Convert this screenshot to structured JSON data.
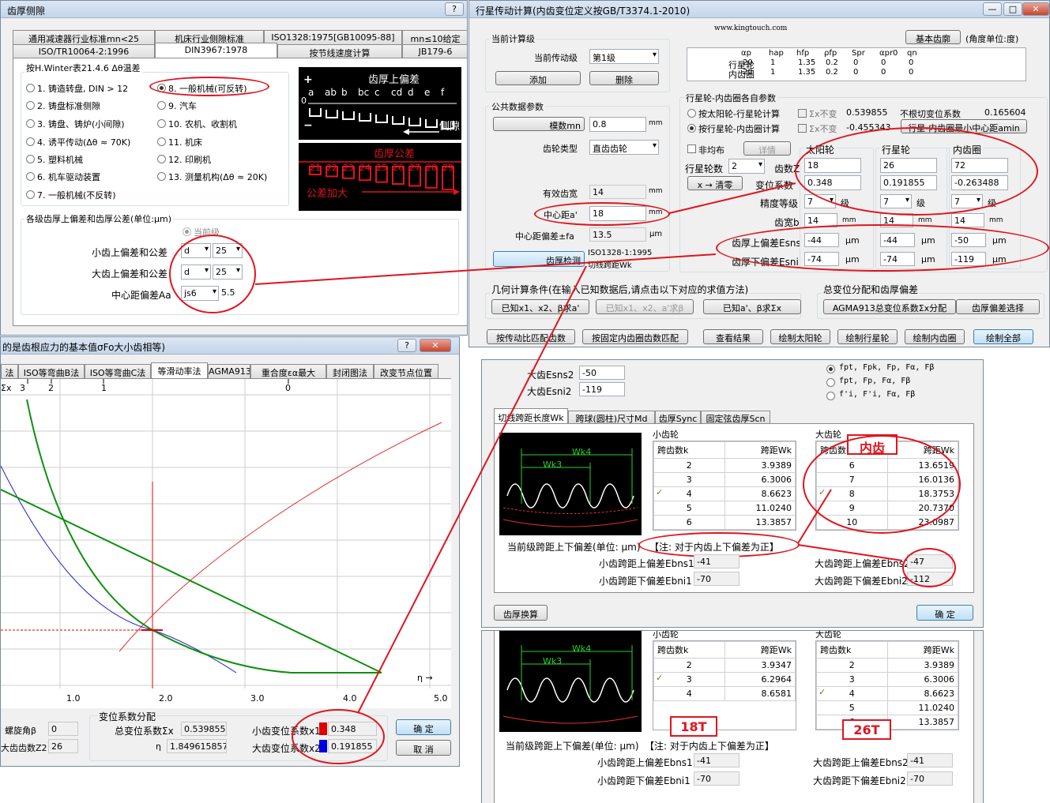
{
  "w1": {
    "title": "齿厚侧隙",
    "tabs_row1": [
      "通用减速器行业标准mn<25",
      "机床行业侧隙标准",
      "ISO1328:1975[GB10095-88]",
      "mn≤10给定"
    ],
    "tabs_row2": [
      "ISO/TR10064-2:1996",
      "DIN3967:1978",
      "按节线速度计算",
      "JB179-6"
    ],
    "group_title": "按H.Winter表21.4.6 Δθ温差",
    "options": [
      "1. 铸造转盘, DIN > 12",
      "2. 铸盘标准侧隙",
      "3. 铸盘、铸炉(小间隙)",
      "4. 诱平传动(Δθ ≈ 70K)",
      "5. 塑料机械",
      "6. 机车驱动装置",
      "7. 一般机械(不反转)",
      "8. 一般机械(可反转)",
      "9. 汽车",
      "10. 农机、收割机",
      "11. 机床",
      "12. 印刷机",
      "13. 测量机构(Δθ ≈ 20K)"
    ],
    "img_top_title": "齿厚上偏差",
    "img_top_letters": [
      "a",
      "ab",
      "b",
      "bc",
      "c",
      "cd",
      "d",
      "e",
      "f"
    ],
    "img_top_plus": "+",
    "img_top_zero": "0",
    "img_top_minus": "−",
    "img_top_label": "侧隙",
    "img_bot_title": "齿厚公差",
    "img_bot_nums": [
      "21",
      "22",
      "23",
      "24",
      "25",
      "26",
      "27",
      "28",
      "29"
    ],
    "img_bot_label": "公差加大",
    "sec_title": "各级齿厚上偏差和齿厚公差(单位:μm)",
    "current": "当前级",
    "small_label": "小齿上偏差和公差",
    "small_a": "d",
    "small_b": "25",
    "big_label": "大齿上偏差和公差",
    "big_a": "d",
    "big_b": "25",
    "cd_label": "中心距偏差Aa",
    "cd_sel": "js6",
    "cd_val": "5.5"
  },
  "w2": {
    "title": "的是齿根应力的基本值σFo大小齿相等)",
    "tabs": [
      "法",
      "ISO等弯曲B法",
      "ISO等弯曲C法",
      "等滑动率法",
      "AGMA913",
      "重合度εα最大",
      "封闭图法",
      "改变节点位置"
    ],
    "sx_label": "Σx",
    "top_ticks": [
      "3",
      "2",
      "1",
      "0"
    ],
    "x_ticks": [
      "1.0",
      "2.0",
      "3.0",
      "4.0",
      "5.0"
    ],
    "eta": "η →",
    "helix_label": "螺旋角β",
    "helix_val": "0",
    "z2_label": "大齿齿数Z2",
    "z2_val": "26",
    "dist_title": "变位系数分配",
    "sum_label": "总变位系数Σx",
    "sum_val": "0.539855",
    "eta_label": "η",
    "eta_val": "1.849615857",
    "x1_label": "小齿变位系数x1",
    "x1_val": "0.348",
    "x2_label": "大齿变位系数x2",
    "x2_val": "0.191855",
    "ok": "确 定",
    "cancel": "取 消"
  },
  "w3": {
    "title": "行星传动计算(内齿变位定义按GB/T3374.1-2010)",
    "website": "www.kingtouch.com",
    "basic_btn": "基本齿廓",
    "angle_unit": "(角度单位:度)",
    "stage_title": "当前计算级",
    "stage_label": "当前传动级",
    "stage_val": "第1级",
    "add": "添加",
    "del": "删除",
    "tbl_head": [
      "αp",
      "hap",
      "hfp",
      "ρfp",
      "Spr",
      "αpr0",
      "qn"
    ],
    "tbl_rows": [
      {
        "name": "行星轮",
        "v": [
          "20",
          "1",
          "1.35",
          "0.2",
          "0",
          "0",
          "0"
        ]
      },
      {
        "name": "内齿圈",
        "v": [
          "20",
          "1",
          "1.35",
          "0.2",
          "0",
          "0",
          "0"
        ]
      }
    ],
    "common_title": "公共数据参数",
    "mn_btn": "模数mn",
    "mn_val": "0.8",
    "mm": "mm",
    "type_label": "齿轮类型",
    "type_val": "直齿齿轮",
    "eff_label": "有效齿宽",
    "eff_val": "14",
    "cd_label": "中心距a'",
    "cd_val": "18",
    "cdd_label": "中心距偏差±fa",
    "cdd_val": "13.5",
    "um": "μm",
    "check_btn": "齿厚检测",
    "iso": "ISO1328-1:1995",
    "wk": "切线跨距Wk",
    "own_title": "行星轮-内齿圈各自参数",
    "r1": "按太阳轮-行星轮计算",
    "r2": "按行星轮-内齿圈计算",
    "sx1": "Σx不变",
    "sx1_val": "0.539855",
    "sx2": "Σx不变",
    "sx2_val": "-0.455343",
    "undercut": "不根切变位系数",
    "undercut_val": "0.165604",
    "amin_btn": "行星-内齿圈最小中心距amin",
    "nonuni": "非均布",
    "detail": "详情",
    "planets_label": "行星轮数",
    "planets_val": "2",
    "clear_btn": "x → 清零",
    "teeth_label": "齿数Z",
    "shift_label": "变位系数",
    "prec_label": "精度等级",
    "width_label": "齿宽b",
    "esns_label": "齿厚上偏差Esns",
    "esni_label": "齿厚下偏差Esni",
    "level": "级",
    "cols": [
      {
        "title": "太阳轮",
        "z": "18",
        "x": "0.348",
        "p": "7",
        "b": "14",
        "esns": "-44",
        "esni": "-74"
      },
      {
        "title": "行星轮",
        "z": "26",
        "x": "0.191855",
        "p": "7",
        "b": "14",
        "esns": "-44",
        "esni": "-74"
      },
      {
        "title": "内齿圈",
        "z": "72",
        "x": "-0.263488",
        "p": "7",
        "b": "14",
        "esns": "-50",
        "esni": "-119"
      }
    ],
    "geo_title": "几何计算条件(在输入已知数据后,请点击以下对应的求值方法)",
    "g1": "已知x1、x2、β求a'",
    "g2": "已知x1、x2、a'求β",
    "g3": "已知a'、β求Σx",
    "dist_title": "总变位分配和齿厚偏差",
    "agma": "AGMA913总变位系数Σx分配",
    "thick_sel": "齿厚偏差选择",
    "b1": "按传动比匹配齿数",
    "b2": "按固定内齿圈齿数匹配",
    "b3": "查看结果",
    "b4": "绘制太阳轮",
    "b5": "绘制行星轮",
    "b6": "绘制内齿圈",
    "b7": "绘制全部"
  },
  "w4": {
    "esns2_label": "大齿Esns2",
    "esns2_val": "-50",
    "esni2_label": "大齿Esni2",
    "esni2_val": "-119",
    "opt1": "fpt, Fpk, Fp, Fα, Fβ",
    "opt2": "fpt, Fp, Fα, Fβ",
    "opt3": "f'i, F'i, Fα, Fβ",
    "tabs": [
      "切线跨距长度Wk",
      "跨球(圆柱)尺寸Md",
      "齿厚Sync",
      "固定弦齿厚Scn"
    ],
    "small": "小齿轮",
    "big": "大齿轮",
    "col_k": "跨齿数k",
    "col_w": "跨距Wk",
    "small_rows": [
      [
        "2",
        "3.9389"
      ],
      [
        "3",
        "6.3006"
      ],
      [
        "4",
        "8.6623"
      ],
      [
        "5",
        "11.0240"
      ],
      [
        "6",
        "13.3857"
      ]
    ],
    "big_rows": [
      [
        "6",
        "13.6519"
      ],
      [
        "7",
        "16.0136"
      ],
      [
        "8",
        "18.3753"
      ],
      [
        "9",
        "20.7370"
      ],
      [
        "10",
        "23.0987"
      ]
    ],
    "wk4": "Wk4",
    "wk3": "Wk3",
    "dev_title": "当前级跨距上下偏差(单位: μm)",
    "note": "【注: 对于内齿上下偏差为正】",
    "ebns1_label": "小齿跨距上偏差Ebns1",
    "ebns1": "-41",
    "ebni1_label": "小齿跨距下偏差Ebni1",
    "ebni1": "-70",
    "ebns2_label": "大齿跨距上偏差Ebns2",
    "ebns2": "-47",
    "ebni2_label": "大齿跨距下偏差Ebni2",
    "ebni2": "-112",
    "convert": "齿厚换算",
    "ok": "确 定",
    "annot": "内齿"
  },
  "w5": {
    "small": "小齿轮",
    "big": "大齿轮",
    "col_k": "跨齿数k",
    "col_w": "跨距Wk",
    "small_rows": [
      [
        "2",
        "3.9347"
      ],
      [
        "3",
        "6.2964"
      ],
      [
        "4",
        "8.6581"
      ]
    ],
    "big_rows": [
      [
        "2",
        "3.9389"
      ],
      [
        "3",
        "6.3006"
      ],
      [
        "4",
        "8.6623"
      ],
      [
        "5",
        "11.0240"
      ],
      [
        "6",
        "13.3857"
      ]
    ],
    "wk4": "Wk4",
    "wk3": "Wk3",
    "annot1": "18T",
    "annot2": "26T",
    "dev_title": "当前级跨距上下偏差(单位: μm)",
    "note": "【注: 对于内齿上下偏差为正】",
    "ebns1_label": "小齿跨距上偏差Ebns1",
    "ebns1": "-41",
    "ebni1_label": "小齿跨距下偏差Ebni1",
    "ebni1": "-70",
    "ebns2_label": "大齿跨距上偏差Ebns2",
    "ebns2": "-41",
    "ebni2_label": "大齿跨距下偏差Ebni2",
    "ebni2": "-70"
  }
}
